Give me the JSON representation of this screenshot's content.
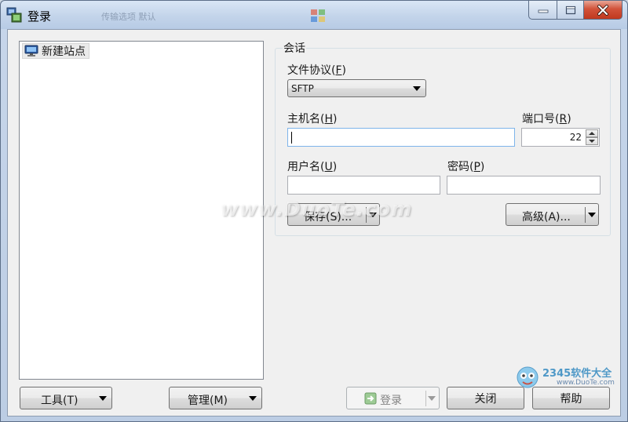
{
  "window": {
    "title": "登录",
    "ghost_title_1": "传输选项 默认",
    "controls": {
      "minimize": "minimize",
      "maximize": "maximize",
      "close": "close"
    }
  },
  "tree": {
    "items": [
      {
        "label": "新建站点",
        "icon": "computer-icon"
      }
    ]
  },
  "session": {
    "group_label": "会话",
    "protocol": {
      "label": "文件协议",
      "accel": "F",
      "value": "SFTP"
    },
    "host": {
      "label": "主机名",
      "accel": "H",
      "value": ""
    },
    "port": {
      "label": "端口号",
      "accel": "R",
      "value": "22"
    },
    "user": {
      "label": "用户名",
      "accel": "U",
      "value": ""
    },
    "password": {
      "label": "密码",
      "accel": "P",
      "value": ""
    },
    "save_button": "保存(S)...",
    "advanced_button": "高级(A)..."
  },
  "footer": {
    "tools_button": "工具(T)",
    "manage_button": "管理(M)",
    "login_button": "登录",
    "close_button": "关闭",
    "help_button": "帮助"
  },
  "watermark": {
    "site": "www.DuoTe.com",
    "brand": "2345软件大全",
    "brand_url": "www.DuoTe.com"
  },
  "colors": {
    "titlebar": "#c3d4ea",
    "close_button": "#c0391f",
    "focus_border": "#7eb4ea",
    "login_icon": "#4caf50"
  }
}
